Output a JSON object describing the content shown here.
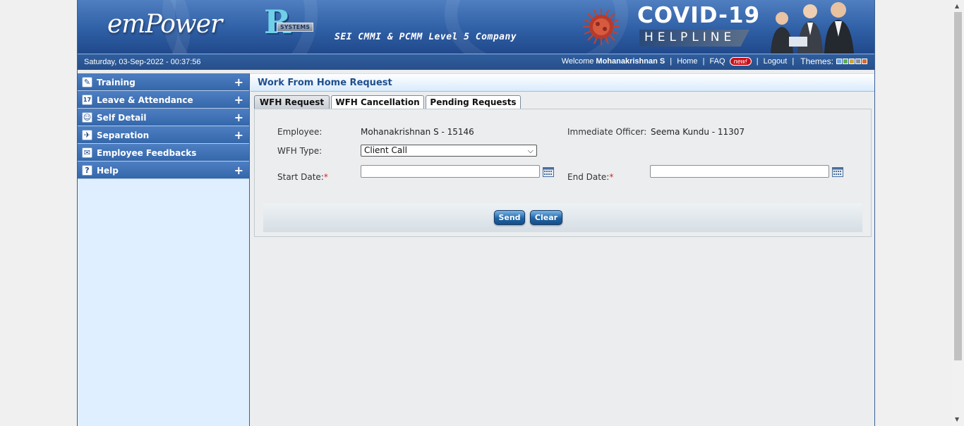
{
  "banner": {
    "logo_text": "emPower",
    "partner_logo_text": "SYSTEMS",
    "tagline": "SEI CMMI & PCMM Level 5 Company",
    "covid_title": "COVID-19",
    "helpline": "HELPLINE"
  },
  "infobar": {
    "datetime": "Saturday, 03-Sep-2022 - 00:37:56",
    "welcome": "Welcome",
    "username": "Mohanakrishnan S",
    "home": "Home",
    "faq": "FAQ",
    "new_badge": "new!",
    "logout": "Logout",
    "themes": "Themes:",
    "theme_colors": [
      "#6fa6e0",
      "#5fae55",
      "#c8a83a",
      "#8a8f96",
      "#d66a2e"
    ]
  },
  "sidebar": {
    "items": [
      {
        "label": "Training",
        "icon": "training-icon",
        "glyph": "✎",
        "expandable": true
      },
      {
        "label": "Leave & Attendance",
        "icon": "calendar-icon",
        "glyph": "17",
        "expandable": true
      },
      {
        "label": "Self Detail",
        "icon": "user-icon",
        "glyph": "☺",
        "expandable": true
      },
      {
        "label": "Separation",
        "icon": "separation-icon",
        "glyph": "✈",
        "expandable": true
      },
      {
        "label": "Employee Feedbacks",
        "icon": "feedback-icon",
        "glyph": "✉",
        "expandable": false
      },
      {
        "label": "Help",
        "icon": "help-icon",
        "glyph": "?",
        "expandable": true
      }
    ],
    "expand_symbol": "+"
  },
  "main": {
    "title": "Work From Home Request",
    "tabs": [
      {
        "label": "WFH Request",
        "active": true
      },
      {
        "label": "WFH Cancellation",
        "active": false
      },
      {
        "label": "Pending Requests",
        "active": false
      }
    ],
    "form": {
      "employee_label": "Employee:",
      "employee_value": "Mohanakrishnan S - 15146",
      "officer_label": "Immediate Officer:",
      "officer_value": "Seema Kundu - 11307",
      "wfh_type_label": "WFH Type:",
      "wfh_type_value": "Client Call",
      "start_date_label": "Start Date:",
      "start_date_value": "",
      "end_date_label": "End Date:",
      "end_date_value": "",
      "required_mark": "*"
    },
    "buttons": {
      "send": "Send",
      "clear": "Clear"
    }
  }
}
